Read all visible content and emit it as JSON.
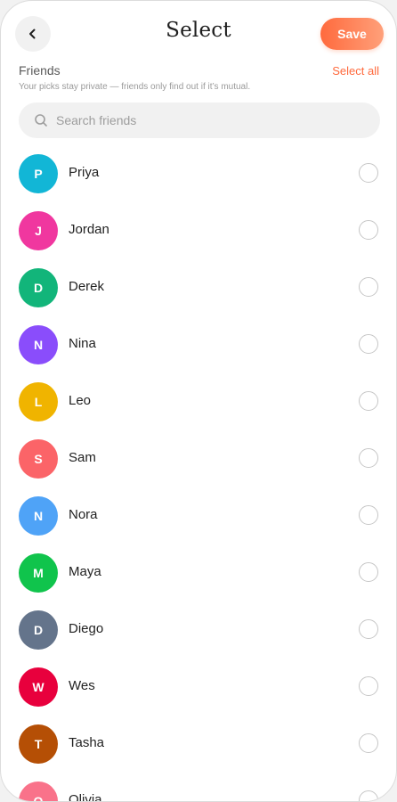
{
  "header": {
    "title": "Select",
    "save_label": "Save"
  },
  "section": {
    "label": "Friends",
    "select_all_label": "Select all",
    "privacy_note": "Your picks stay private — friends only find out if it’s mutual."
  },
  "search": {
    "placeholder": "Search friends",
    "value": ""
  },
  "icons": {
    "back": "chevron-left-icon",
    "search": "search-icon"
  },
  "colors": {
    "accent": "#ff6a3d",
    "accent_light": "#ffa07a"
  },
  "friends": [
    {
      "initial": "P",
      "name": "Priya",
      "color": "#12b6d6",
      "selected": false
    },
    {
      "initial": "J",
      "name": "Jordan",
      "color": "#f0379f",
      "selected": false
    },
    {
      "initial": "D",
      "name": "Derek",
      "color": "#12b57a",
      "selected": false
    },
    {
      "initial": "N",
      "name": "Nina",
      "color": "#8a4dfb",
      "selected": false
    },
    {
      "initial": "L",
      "name": "Leo",
      "color": "#f0b400",
      "selected": false
    },
    {
      "initial": "S",
      "name": "Sam",
      "color": "#fb6468",
      "selected": false
    },
    {
      "initial": "N",
      "name": "Nora",
      "color": "#4fa3f7",
      "selected": false
    },
    {
      "initial": "M",
      "name": "Maya",
      "color": "#10c44c",
      "selected": false
    },
    {
      "initial": "D",
      "name": "Diego",
      "color": "#64748b",
      "selected": false
    },
    {
      "initial": "W",
      "name": "Wes",
      "color": "#e8003d",
      "selected": false
    },
    {
      "initial": "T",
      "name": "Tasha",
      "color": "#b54f05",
      "selected": false
    },
    {
      "initial": "O",
      "name": "Olivia",
      "color": "#f9728a",
      "selected": false
    }
  ]
}
